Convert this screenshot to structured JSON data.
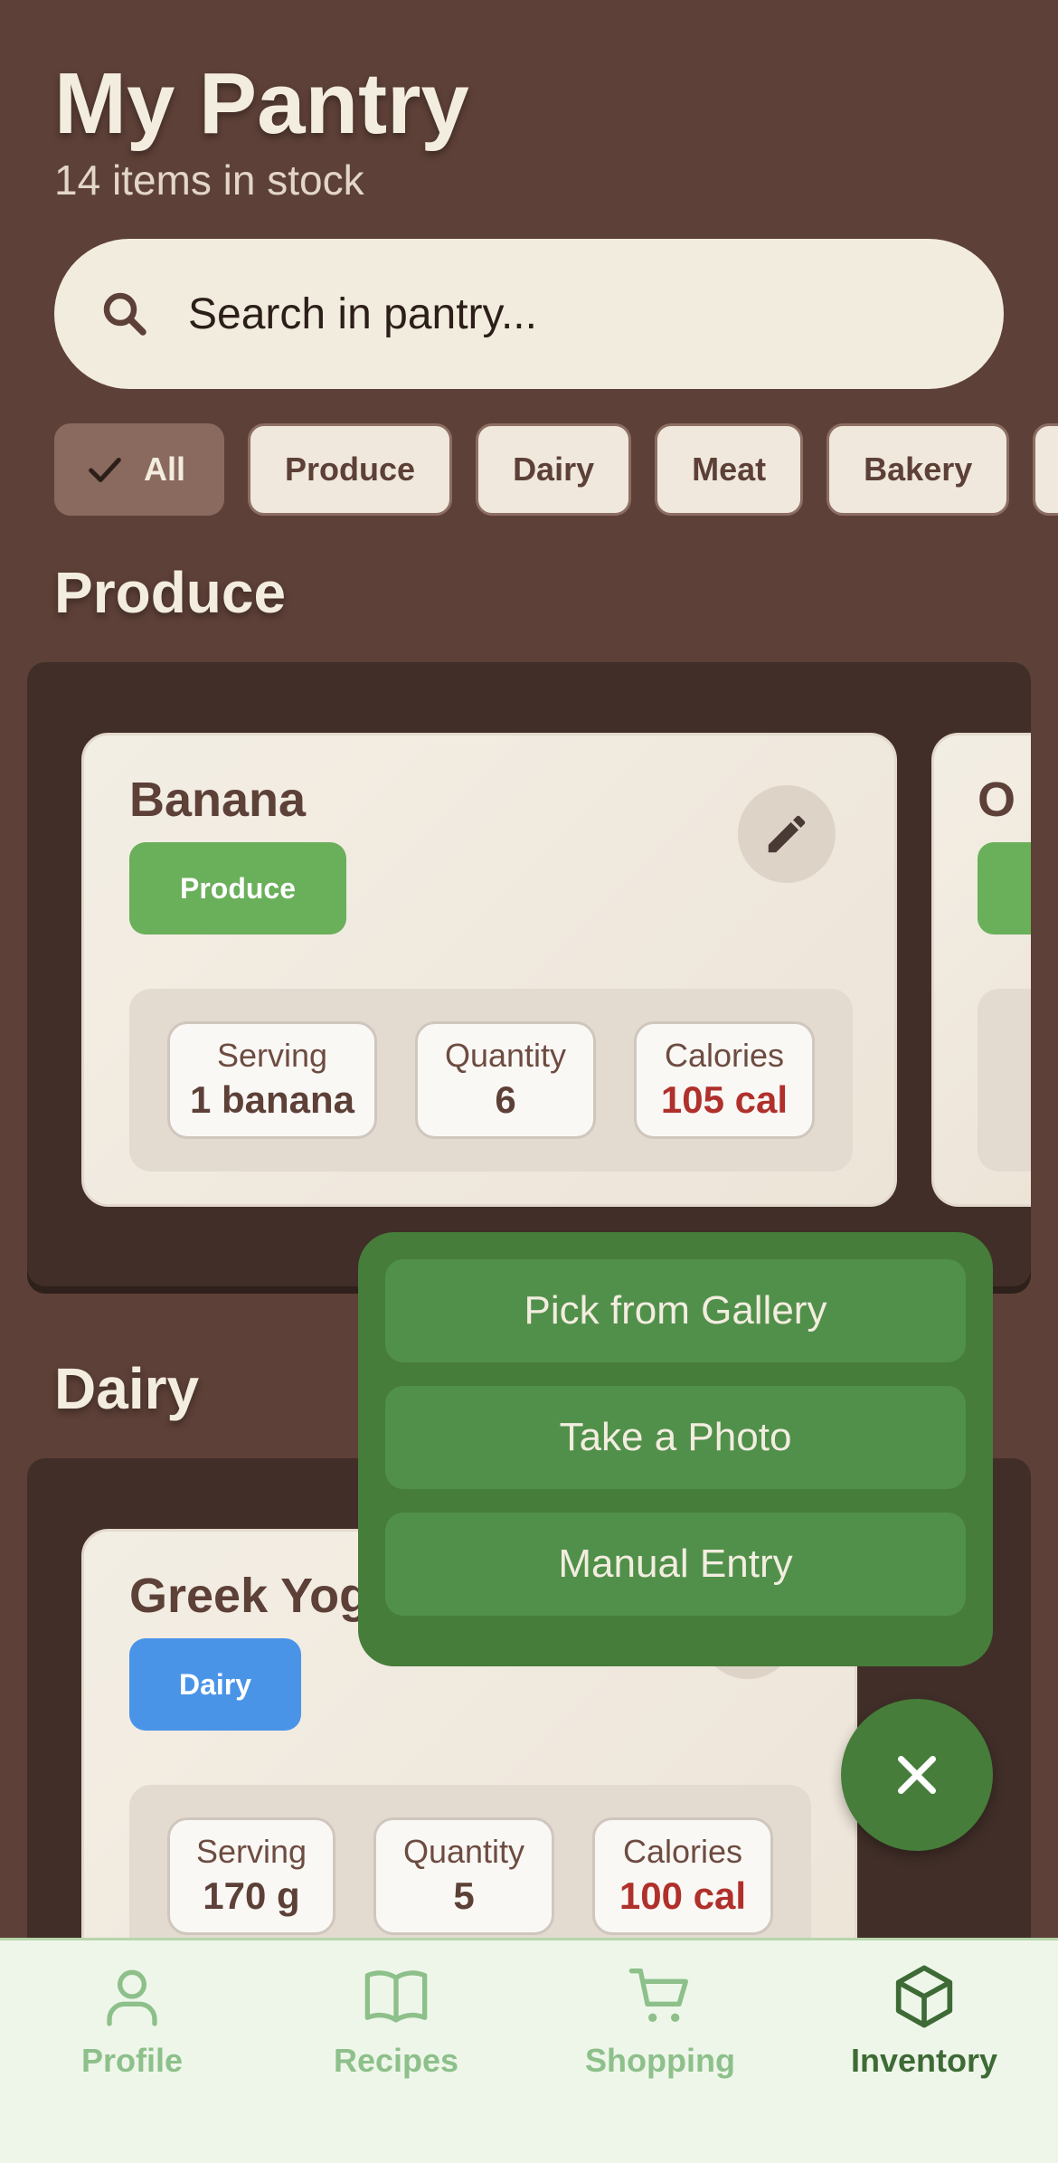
{
  "header": {
    "title": "My Pantry",
    "subtitle": "14 items in stock"
  },
  "search": {
    "placeholder": "Search in pantry...",
    "icon": "search-icon"
  },
  "filters": {
    "active": "All",
    "chips": [
      "All",
      "Produce",
      "Dairy",
      "Meat",
      "Bakery"
    ]
  },
  "sections": [
    {
      "title": "Produce",
      "items": [
        {
          "name": "Banana",
          "category": "Produce",
          "category_color": "#6AAF5A",
          "stats": {
            "serving_label": "Serving",
            "serving": "1 banana",
            "quantity_label": "Quantity",
            "quantity": "6",
            "calories_label": "Calories",
            "calories": "105 cal"
          }
        },
        {
          "name": "O",
          "category": "",
          "category_color": "#6AAF5A"
        }
      ]
    },
    {
      "title": "Dairy",
      "items": [
        {
          "name": "Greek Yogurt",
          "category": "Dairy",
          "category_color": "#4A94E8",
          "stats": {
            "serving_label": "Serving",
            "serving": "170 g",
            "quantity_label": "Quantity",
            "quantity": "5",
            "calories_label": "Calories",
            "calories": "100 cal"
          }
        }
      ]
    }
  ],
  "add_menu": {
    "items": [
      "Pick from Gallery",
      "Take a Photo",
      "Manual Entry"
    ]
  },
  "fab": {
    "icon": "close-icon"
  },
  "nav": {
    "active": "Inventory",
    "items": [
      {
        "label": "Profile",
        "icon": "profile-icon"
      },
      {
        "label": "Recipes",
        "icon": "book-icon"
      },
      {
        "label": "Shopping",
        "icon": "cart-icon"
      },
      {
        "label": "Inventory",
        "icon": "box-icon"
      }
    ]
  },
  "colors": {
    "background": "#5D4037",
    "panel": "#412E28",
    "accent_green": "#467D3A",
    "calorie_red": "#B0302C",
    "nav_background": "#EEF6E9"
  }
}
